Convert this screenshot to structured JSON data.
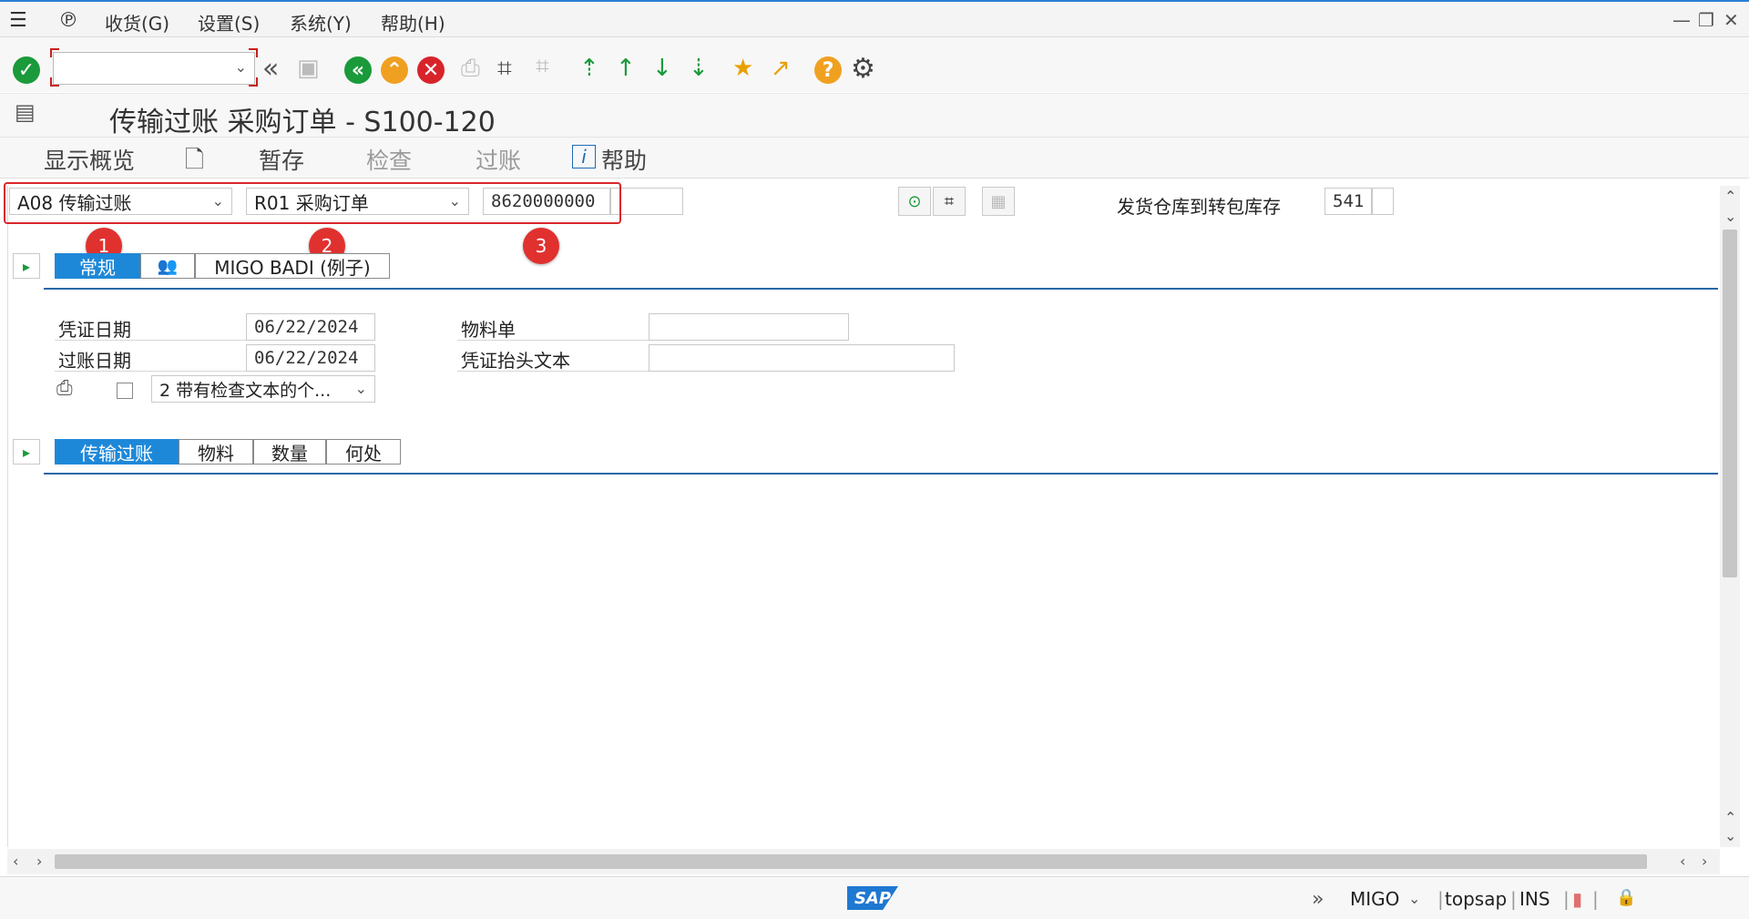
{
  "menu": {
    "items": [
      "收货(G)",
      "设置(S)",
      "系统(Y)",
      "帮助(H)"
    ]
  },
  "title": "传输过账 采购订单 - S100-120",
  "app_toolbar": {
    "show_overview": "显示概览",
    "hold": "暂存",
    "check": "检查",
    "post": "过账",
    "help": "帮助"
  },
  "header": {
    "action": "A08 传输过账",
    "reference": "R01 采购订单",
    "po_number": "8620000000",
    "movement_desc": "发货仓库到转包库存",
    "movement_type": "541"
  },
  "badges": [
    "1",
    "2",
    "3"
  ],
  "header_tabs": {
    "general": "常规",
    "badi": "MIGO BADI (例子)"
  },
  "fields": {
    "doc_date_label": "凭证日期",
    "doc_date": "06/22/2024",
    "posting_date_label": "过账日期",
    "posting_date": "06/22/2024",
    "material_slip_label": "物料单",
    "material_slip": "",
    "header_text_label": "凭证抬头文本",
    "header_text": "",
    "print_option": "2 带有检查文本的个..."
  },
  "detail_tabs": [
    "传输过账",
    "物料",
    "数量",
    "何处"
  ],
  "status": {
    "transaction": "MIGO",
    "user": "topsap",
    "mode": "INS",
    "sap_logo": "SAP"
  },
  "colors": {
    "accent_blue": "#1e88d8",
    "highlight_red": "#d9262c",
    "ok_green": "#1a9a3a"
  }
}
